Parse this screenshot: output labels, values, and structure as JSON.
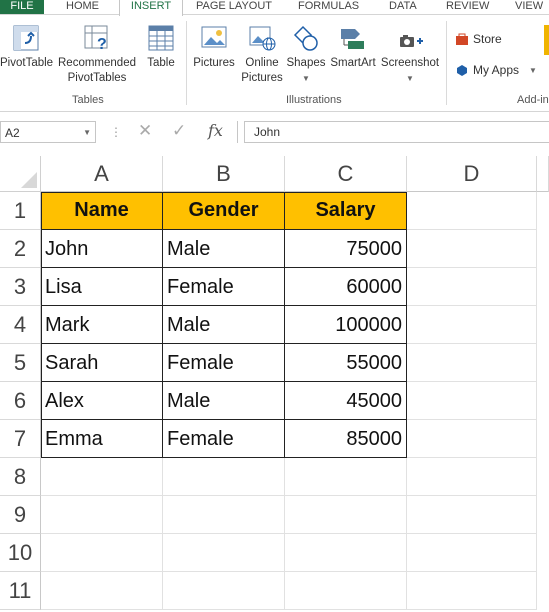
{
  "ribbon_tabs": [
    "FILE",
    "HOME",
    "INSERT",
    "PAGE LAYOUT",
    "FORMULAS",
    "DATA",
    "REVIEW",
    "VIEW"
  ],
  "ribbon": {
    "tables_group_label": "Tables",
    "illustrations_group_label": "Illustrations",
    "addins_group_label": "Add-in",
    "pivottable": "PivotTable",
    "recommended_line1": "Recommended",
    "recommended_line2": "PivotTables",
    "table": "Table",
    "pictures": "Pictures",
    "online_line1": "Online",
    "online_line2": "Pictures",
    "shapes": "Shapes",
    "smartart": "SmartArt",
    "screenshot": "Screenshot",
    "store": "Store",
    "myapps": "My Apps",
    "accent_color": "#217346"
  },
  "formula_bar": {
    "name_box": "A2",
    "cancel_symbol": "✕",
    "enter_symbol": "✓",
    "fx": "fx",
    "content": "John"
  },
  "sheet": {
    "columns": [
      "A",
      "B",
      "C",
      "D"
    ],
    "rows": [
      "1",
      "2",
      "3",
      "4",
      "5",
      "6",
      "7",
      "8",
      "9",
      "10",
      "11"
    ],
    "header_fill": "#ffc000",
    "table": [
      [
        "Name",
        "Gender",
        "Salary"
      ],
      [
        "John",
        "Male",
        "75000"
      ],
      [
        "Lisa",
        "Female",
        "60000"
      ],
      [
        "Mark",
        "Male",
        "100000"
      ],
      [
        "Sarah",
        "Female",
        "55000"
      ],
      [
        "Alex",
        "Male",
        "45000"
      ],
      [
        "Emma",
        "Female",
        "85000"
      ]
    ]
  }
}
